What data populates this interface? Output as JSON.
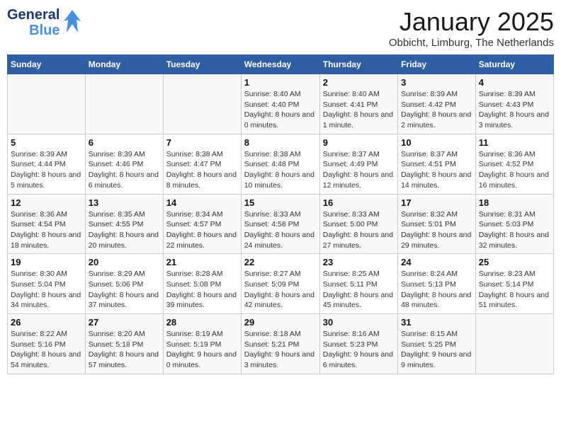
{
  "logo": {
    "general": "General",
    "blue": "Blue"
  },
  "title": "January 2025",
  "subtitle": "Obbicht, Limburg, The Netherlands",
  "days_of_week": [
    "Sunday",
    "Monday",
    "Tuesday",
    "Wednesday",
    "Thursday",
    "Friday",
    "Saturday"
  ],
  "weeks": [
    [
      {
        "day": "",
        "info": ""
      },
      {
        "day": "",
        "info": ""
      },
      {
        "day": "",
        "info": ""
      },
      {
        "day": "1",
        "info": "Sunrise: 8:40 AM\nSunset: 4:40 PM\nDaylight: 8 hours and 0 minutes."
      },
      {
        "day": "2",
        "info": "Sunrise: 8:40 AM\nSunset: 4:41 PM\nDaylight: 8 hours and 1 minute."
      },
      {
        "day": "3",
        "info": "Sunrise: 8:39 AM\nSunset: 4:42 PM\nDaylight: 8 hours and 2 minutes."
      },
      {
        "day": "4",
        "info": "Sunrise: 8:39 AM\nSunset: 4:43 PM\nDaylight: 8 hours and 3 minutes."
      }
    ],
    [
      {
        "day": "5",
        "info": "Sunrise: 8:39 AM\nSunset: 4:44 PM\nDaylight: 8 hours and 5 minutes."
      },
      {
        "day": "6",
        "info": "Sunrise: 8:39 AM\nSunset: 4:46 PM\nDaylight: 8 hours and 6 minutes."
      },
      {
        "day": "7",
        "info": "Sunrise: 8:38 AM\nSunset: 4:47 PM\nDaylight: 8 hours and 8 minutes."
      },
      {
        "day": "8",
        "info": "Sunrise: 8:38 AM\nSunset: 4:48 PM\nDaylight: 8 hours and 10 minutes."
      },
      {
        "day": "9",
        "info": "Sunrise: 8:37 AM\nSunset: 4:49 PM\nDaylight: 8 hours and 12 minutes."
      },
      {
        "day": "10",
        "info": "Sunrise: 8:37 AM\nSunset: 4:51 PM\nDaylight: 8 hours and 14 minutes."
      },
      {
        "day": "11",
        "info": "Sunrise: 8:36 AM\nSunset: 4:52 PM\nDaylight: 8 hours and 16 minutes."
      }
    ],
    [
      {
        "day": "12",
        "info": "Sunrise: 8:36 AM\nSunset: 4:54 PM\nDaylight: 8 hours and 18 minutes."
      },
      {
        "day": "13",
        "info": "Sunrise: 8:35 AM\nSunset: 4:55 PM\nDaylight: 8 hours and 20 minutes."
      },
      {
        "day": "14",
        "info": "Sunrise: 8:34 AM\nSunset: 4:57 PM\nDaylight: 8 hours and 22 minutes."
      },
      {
        "day": "15",
        "info": "Sunrise: 8:33 AM\nSunset: 4:58 PM\nDaylight: 8 hours and 24 minutes."
      },
      {
        "day": "16",
        "info": "Sunrise: 8:33 AM\nSunset: 5:00 PM\nDaylight: 8 hours and 27 minutes."
      },
      {
        "day": "17",
        "info": "Sunrise: 8:32 AM\nSunset: 5:01 PM\nDaylight: 8 hours and 29 minutes."
      },
      {
        "day": "18",
        "info": "Sunrise: 8:31 AM\nSunset: 5:03 PM\nDaylight: 8 hours and 32 minutes."
      }
    ],
    [
      {
        "day": "19",
        "info": "Sunrise: 8:30 AM\nSunset: 5:04 PM\nDaylight: 8 hours and 34 minutes."
      },
      {
        "day": "20",
        "info": "Sunrise: 8:29 AM\nSunset: 5:06 PM\nDaylight: 8 hours and 37 minutes."
      },
      {
        "day": "21",
        "info": "Sunrise: 8:28 AM\nSunset: 5:08 PM\nDaylight: 8 hours and 39 minutes."
      },
      {
        "day": "22",
        "info": "Sunrise: 8:27 AM\nSunset: 5:09 PM\nDaylight: 8 hours and 42 minutes."
      },
      {
        "day": "23",
        "info": "Sunrise: 8:25 AM\nSunset: 5:11 PM\nDaylight: 8 hours and 45 minutes."
      },
      {
        "day": "24",
        "info": "Sunrise: 8:24 AM\nSunset: 5:13 PM\nDaylight: 8 hours and 48 minutes."
      },
      {
        "day": "25",
        "info": "Sunrise: 8:23 AM\nSunset: 5:14 PM\nDaylight: 8 hours and 51 minutes."
      }
    ],
    [
      {
        "day": "26",
        "info": "Sunrise: 8:22 AM\nSunset: 5:16 PM\nDaylight: 8 hours and 54 minutes."
      },
      {
        "day": "27",
        "info": "Sunrise: 8:20 AM\nSunset: 5:18 PM\nDaylight: 8 hours and 57 minutes."
      },
      {
        "day": "28",
        "info": "Sunrise: 8:19 AM\nSunset: 5:19 PM\nDaylight: 9 hours and 0 minutes."
      },
      {
        "day": "29",
        "info": "Sunrise: 8:18 AM\nSunset: 5:21 PM\nDaylight: 9 hours and 3 minutes."
      },
      {
        "day": "30",
        "info": "Sunrise: 8:16 AM\nSunset: 5:23 PM\nDaylight: 9 hours and 6 minutes."
      },
      {
        "day": "31",
        "info": "Sunrise: 8:15 AM\nSunset: 5:25 PM\nDaylight: 9 hours and 9 minutes."
      },
      {
        "day": "",
        "info": ""
      }
    ]
  ]
}
